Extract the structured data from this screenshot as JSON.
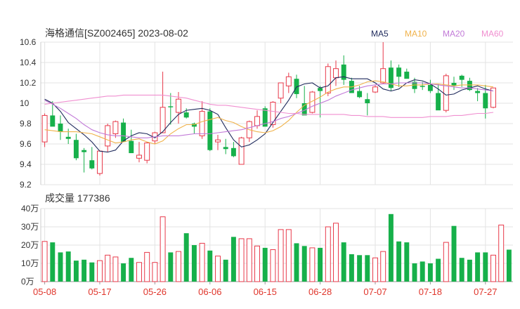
{
  "header": {
    "title": "海格通信[SZ002465] 2023-08-02",
    "legend": [
      {
        "label": "MA5",
        "color": "#1f2a5c"
      },
      {
        "label": "MA10",
        "color": "#f0b24a"
      },
      {
        "label": "MA20",
        "color": "#c27ad8"
      },
      {
        "label": "MA60",
        "color": "#f08fd0"
      }
    ]
  },
  "volume_panel": {
    "label": "成交量 177386"
  },
  "colors": {
    "up": "#e8394a",
    "down": "#16b04a",
    "grid": "#e3e3e3",
    "axis": "#666666",
    "date": "#e0352b"
  },
  "chart_data": [
    {
      "type": "candlestick",
      "title": "海格通信[SZ002465] 2023-08-02",
      "ylim": [
        9.2,
        10.6
      ],
      "y_ticks": [
        "10.6",
        "10.4",
        "10.2",
        "10",
        "9.8",
        "9.6",
        "9.4",
        "9.2"
      ],
      "x_ticks": [
        "05-08",
        "05-17",
        "05-26",
        "06-06",
        "06-15",
        "06-28",
        "07-07",
        "07-18",
        "07-27"
      ],
      "x_tick_index": [
        0,
        7,
        14,
        21,
        28,
        35,
        42,
        49,
        56
      ],
      "ohlc": [
        [
          9.62,
          9.9,
          9.57,
          9.88
        ],
        [
          9.88,
          10.02,
          9.85,
          9.77
        ],
        [
          9.8,
          9.88,
          9.64,
          9.72
        ],
        [
          9.67,
          9.75,
          9.6,
          9.65
        ],
        [
          9.64,
          9.7,
          9.44,
          9.46
        ],
        [
          9.54,
          9.56,
          9.32,
          9.52
        ],
        [
          9.44,
          9.57,
          9.35,
          9.36
        ],
        [
          9.31,
          9.52,
          9.29,
          9.53
        ],
        [
          9.58,
          9.8,
          9.52,
          9.78
        ],
        [
          9.7,
          9.83,
          9.66,
          9.82
        ],
        [
          9.81,
          9.85,
          9.62,
          9.62
        ],
        [
          9.63,
          9.74,
          9.53,
          9.51
        ],
        [
          9.46,
          9.62,
          9.42,
          9.49
        ],
        [
          9.44,
          9.62,
          9.41,
          9.61
        ],
        [
          9.63,
          9.72,
          9.6,
          9.71
        ],
        [
          9.71,
          10.31,
          9.71,
          9.96
        ],
        [
          9.97,
          10.1,
          9.79,
          9.96
        ],
        [
          9.91,
          10.11,
          9.8,
          10.04
        ],
        [
          9.91,
          9.95,
          9.85,
          9.86
        ],
        [
          9.8,
          9.81,
          9.7,
          9.77
        ],
        [
          9.68,
          10.02,
          9.65,
          9.92
        ],
        [
          9.92,
          9.95,
          9.53,
          9.54
        ],
        [
          9.62,
          9.69,
          9.54,
          9.64
        ],
        [
          9.57,
          9.65,
          9.5,
          9.55
        ],
        [
          9.56,
          9.62,
          9.47,
          9.48
        ],
        [
          9.4,
          9.67,
          9.4,
          9.66
        ],
        [
          9.66,
          9.83,
          9.62,
          9.82
        ],
        [
          9.78,
          9.93,
          9.75,
          9.87
        ],
        [
          9.95,
          9.97,
          9.8,
          9.77
        ],
        [
          9.79,
          10.02,
          9.76,
          10.01
        ],
        [
          10.05,
          10.2,
          10.0,
          10.2
        ],
        [
          10.17,
          10.3,
          10.1,
          10.26
        ],
        [
          10.24,
          10.28,
          10.05,
          10.09
        ],
        [
          10.0,
          10.17,
          9.93,
          9.88
        ],
        [
          9.91,
          10.12,
          9.9,
          10.11
        ],
        [
          10.15,
          10.17,
          9.86,
          10.12
        ],
        [
          10.1,
          10.39,
          10.07,
          10.36
        ],
        [
          10.25,
          10.42,
          10.17,
          10.34
        ],
        [
          10.38,
          10.47,
          10.18,
          10.23
        ],
        [
          10.22,
          10.25,
          10.1,
          10.1
        ],
        [
          10.12,
          10.17,
          10.05,
          10.06
        ],
        [
          10.04,
          10.1,
          9.88,
          10.0
        ],
        [
          10.11,
          10.18,
          10.1,
          10.16
        ],
        [
          10.2,
          10.6,
          10.19,
          10.34
        ],
        [
          10.35,
          10.42,
          10.12,
          10.15
        ],
        [
          10.35,
          10.38,
          10.16,
          10.26
        ],
        [
          10.31,
          10.34,
          10.27,
          10.24
        ],
        [
          10.21,
          10.25,
          10.1,
          10.14
        ],
        [
          10.17,
          10.21,
          10.13,
          10.16
        ],
        [
          10.18,
          10.23,
          10.1,
          10.12
        ],
        [
          10.1,
          10.19,
          10.0,
          9.93
        ],
        [
          9.93,
          10.29,
          9.91,
          10.27
        ],
        [
          10.2,
          10.26,
          10.13,
          10.17
        ],
        [
          10.27,
          10.28,
          10.16,
          10.23
        ],
        [
          10.22,
          10.25,
          10.12,
          10.13
        ],
        [
          10.12,
          10.15,
          10.02,
          10.1
        ],
        [
          10.1,
          10.18,
          9.85,
          9.95
        ],
        [
          9.96,
          10.14,
          9.95,
          10.15
        ]
      ],
      "ma5": [
        10.04,
        10.0,
        9.92,
        9.81,
        9.75,
        9.69,
        9.62,
        9.53,
        9.52,
        9.54,
        9.63,
        9.68,
        9.71,
        9.7,
        9.66,
        9.72,
        9.81,
        9.89,
        9.93,
        9.94,
        9.95,
        9.93,
        9.89,
        9.76,
        9.64,
        9.57,
        9.59,
        9.64,
        9.7,
        9.81,
        9.92,
        10.03,
        10.16,
        10.19,
        10.2,
        10.15,
        10.17,
        10.25,
        10.26,
        10.24,
        10.24,
        10.24,
        10.2,
        10.14,
        10.12,
        10.14,
        10.2,
        10.23,
        10.22,
        10.19,
        10.14,
        10.08,
        10.09,
        10.13,
        10.15,
        10.17,
        10.14,
        10.12
      ],
      "ma10": [
        9.74,
        9.73,
        9.72,
        9.72,
        9.72,
        9.71,
        9.7,
        9.67,
        9.64,
        9.61,
        9.62,
        9.64,
        9.65,
        9.62,
        9.6,
        9.63,
        9.7,
        9.75,
        9.79,
        9.79,
        9.82,
        9.84,
        9.86,
        9.83,
        9.81,
        9.77,
        9.74,
        9.72,
        9.71,
        9.73,
        9.77,
        9.83,
        9.91,
        9.98,
        10.02,
        10.06,
        10.11,
        10.14,
        10.16,
        10.16,
        10.18,
        10.21,
        10.22,
        10.21,
        10.19,
        10.17,
        10.17,
        10.18,
        10.18,
        10.19,
        10.19,
        10.18,
        10.17,
        10.18,
        10.18,
        10.18,
        10.17,
        10.16
      ],
      "ma20": [
        10.03,
        9.99,
        9.95,
        9.9,
        9.85,
        9.79,
        9.74,
        9.71,
        9.69,
        9.68,
        9.68,
        9.67,
        9.66,
        9.66,
        9.67,
        9.68,
        9.68,
        9.68,
        9.69,
        9.7,
        9.7,
        9.7,
        9.71,
        9.72,
        9.73,
        9.74,
        9.76,
        9.78,
        9.8,
        9.82,
        9.85,
        9.87,
        9.9,
        9.93,
        9.97,
        10.0,
        10.03,
        10.07,
        10.1,
        10.13,
        10.15,
        10.17,
        10.18,
        10.19,
        10.19,
        10.2,
        10.2,
        10.2,
        10.2,
        10.19,
        10.18,
        10.17,
        10.16,
        10.15,
        10.15,
        10.14,
        10.13,
        10.12
      ],
      "ma60": [
        9.99,
        10.0,
        10.01,
        10.02,
        10.03,
        10.04,
        10.05,
        10.06,
        10.07,
        10.07,
        10.08,
        10.08,
        10.08,
        10.08,
        10.08,
        10.08,
        10.07,
        10.06,
        10.05,
        10.03,
        10.01,
        9.99,
        9.98,
        9.98,
        9.97,
        9.96,
        9.95,
        9.94,
        9.93,
        9.92,
        9.91,
        9.9,
        9.9,
        9.89,
        9.89,
        9.89,
        9.89,
        9.89,
        9.89,
        9.88,
        9.88,
        9.87,
        9.87,
        9.87,
        9.86,
        9.86,
        9.86,
        9.86,
        9.86,
        9.87,
        9.87,
        9.87,
        9.88,
        9.88,
        9.89,
        9.9,
        9.9,
        9.91
      ]
    },
    {
      "type": "bar",
      "title": "成交量 177386",
      "ylim": [
        0,
        40
      ],
      "y_ticks": [
        "40万",
        "30万",
        "20万",
        "10万",
        "0万"
      ],
      "y_tick_values": [
        40,
        30,
        20,
        10,
        0
      ],
      "values": [
        22,
        21.5,
        16,
        16.5,
        11.5,
        12,
        10.5,
        11.5,
        14.5,
        13.5,
        10,
        13,
        10.5,
        16,
        10.5,
        35.5,
        16,
        16.5,
        26.5,
        20,
        21,
        17,
        14,
        12,
        24.5,
        23.5,
        23.5,
        19.5,
        18.5,
        17.5,
        28.5,
        28.5,
        21,
        19.5,
        18.5,
        18.5,
        30,
        32,
        21.5,
        15,
        14.5,
        14.5,
        13,
        16.5,
        37,
        22,
        21.5,
        10,
        11,
        10,
        12.5,
        21.5,
        30.5,
        13,
        12,
        16,
        16,
        14.5,
        31,
        17.5
      ]
    }
  ]
}
